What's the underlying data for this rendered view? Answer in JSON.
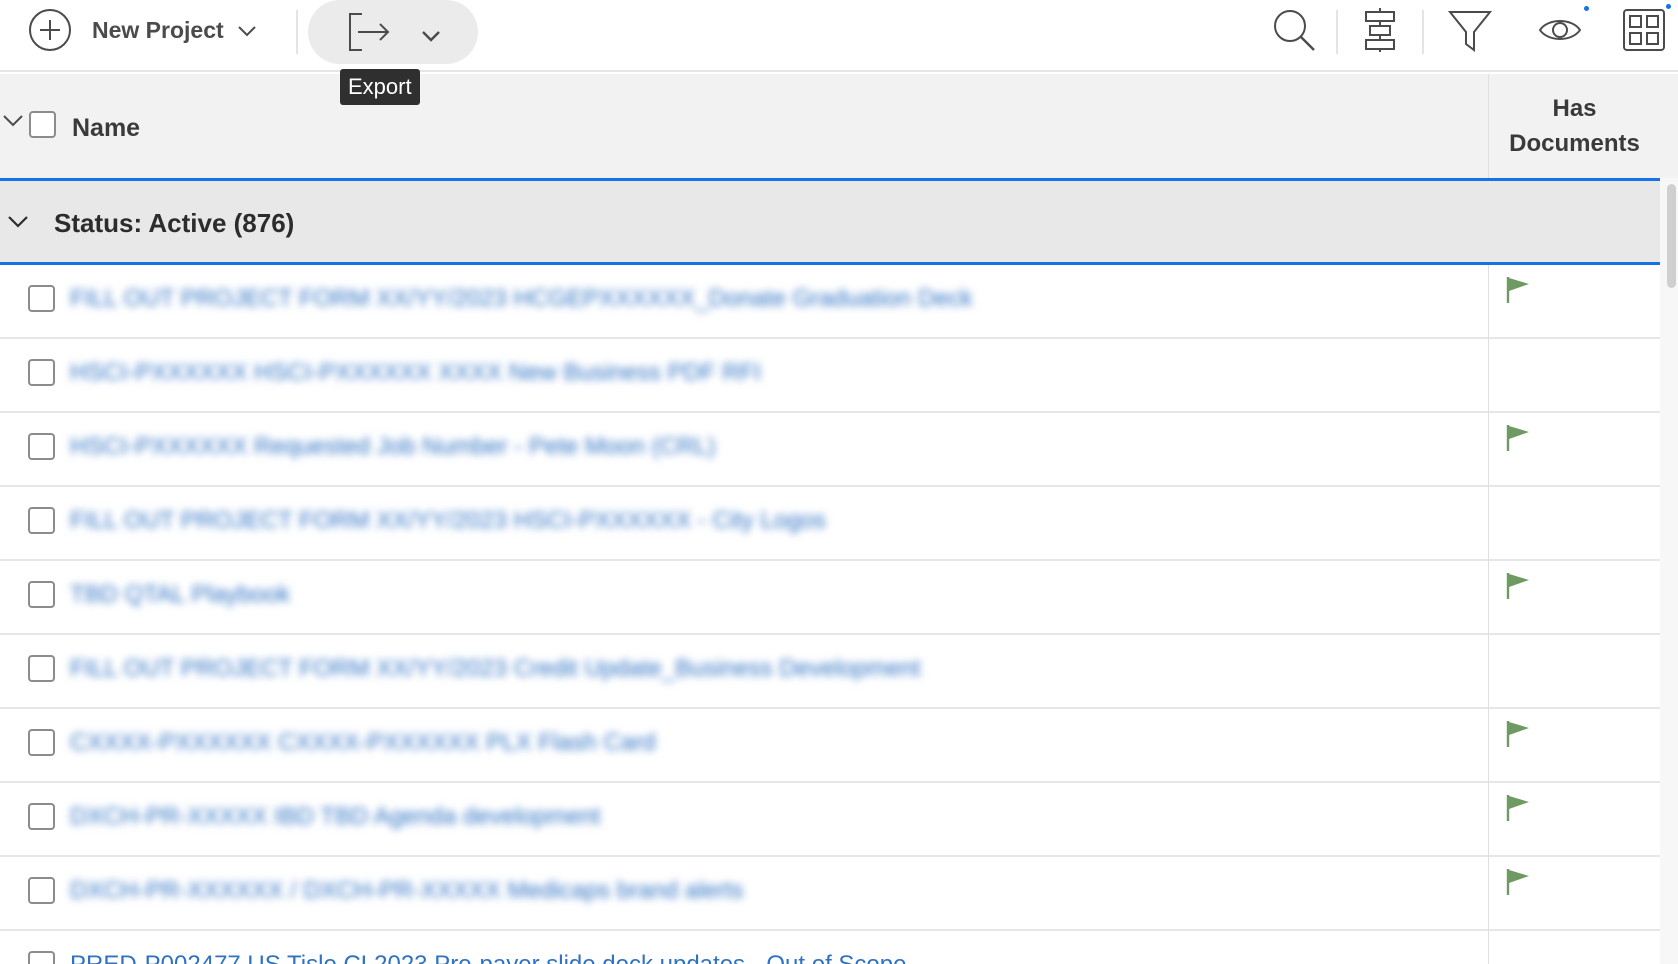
{
  "toolbar": {
    "new_project_label": "New Project",
    "export_tooltip": "Export",
    "icons": [
      "search-icon",
      "grouping-icon",
      "filter-icon",
      "view-icon",
      "grid-icon"
    ]
  },
  "table": {
    "name_header": "Name",
    "has_documents_header_line1": "Has",
    "has_documents_header_line2": "Documents",
    "group_label": "Status: Active (876)"
  },
  "rows": [
    {
      "name": "FILL OUT PROJECT FORM XX/YY/2023 HCGEPXXXXXX_Donate Graduation Deck",
      "has_documents": true
    },
    {
      "name": "HSCI-PXXXXXX HSCI-PXXXXXX XXXX New Business PDF RFI",
      "has_documents": false
    },
    {
      "name": "HSCI-PXXXXXX Requested Job Number - Pete Moon (CRL)",
      "has_documents": true
    },
    {
      "name": "FILL OUT PROJECT FORM XX/YY/2023 HSCI-PXXXXXX - City Logos",
      "has_documents": false
    },
    {
      "name": "TBD QTAL Playbook",
      "has_documents": true
    },
    {
      "name": "FILL OUT PROJECT FORM XX/YY/2023 Credit Update_Business Development",
      "has_documents": false
    },
    {
      "name": "CXXXX-PXXXXXX CXXXX-PXXXXXX PLX Flash Card",
      "has_documents": true
    },
    {
      "name": "DXCH-PR-XXXXX IBD TBD Agenda development",
      "has_documents": true
    },
    {
      "name": "DXCH-PR-XXXXXX / DXCH-PR-XXXXX Medicaps brand alerts",
      "has_documents": true
    },
    {
      "name": "PRED-P002477 US Tisle CL2023 Pre-payer slide deck updates - Out of Scope",
      "has_documents": false
    }
  ],
  "colors": {
    "accent": "#1473e6",
    "link": "#2f72c4",
    "flag": "#6f9a62"
  }
}
